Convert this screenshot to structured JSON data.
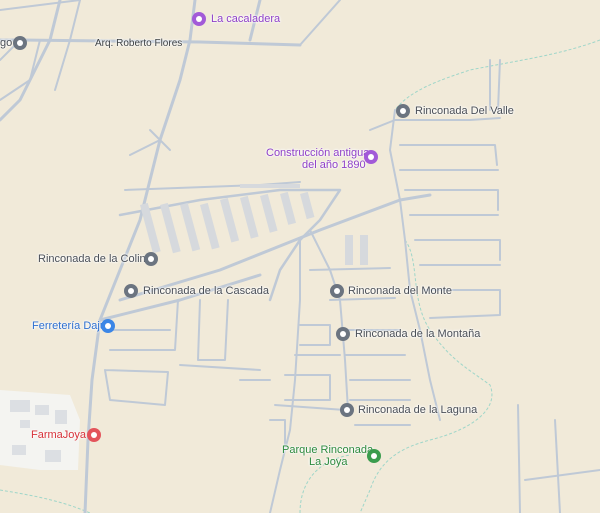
{
  "map": {
    "roads": [
      {
        "label": "Arq. Roberto Flores"
      }
    ],
    "places": [
      {
        "name": "La cacaladera",
        "category": "purple",
        "icon": "camera-icon"
      },
      {
        "name": "Rinconada Del Valle",
        "category": "grey",
        "icon": "pin-icon"
      },
      {
        "name": "Construcción antigua",
        "name_line2": "del año 1890",
        "category": "purple",
        "icon": "monument-icon"
      },
      {
        "name": "Rinconada de la Colina",
        "category": "grey",
        "icon": "pin-icon"
      },
      {
        "name": "Rinconada de la Cascada",
        "category": "grey",
        "icon": "pin-icon"
      },
      {
        "name": "Rinconada del Monte",
        "category": "grey",
        "icon": "pin-icon"
      },
      {
        "name": "Ferretería Dajui",
        "category": "blue",
        "icon": "shopping-bag-icon"
      },
      {
        "name": "Rinconada de la Montaña",
        "category": "grey",
        "icon": "pin-icon"
      },
      {
        "name": "Rinconada de la Laguna",
        "category": "grey",
        "icon": "pin-icon"
      },
      {
        "name": "FarmaJoya",
        "category": "red",
        "icon": "pharmacy-icon"
      },
      {
        "name": "Parque Rinconada",
        "name_line2": "La Joya",
        "category": "green",
        "icon": "tree-icon"
      },
      {
        "name": "go",
        "category": "grey",
        "icon": "pin-icon"
      }
    ],
    "colors": {
      "land": "#f1ead9",
      "road": "#bfc9d6",
      "road_outline": "#a9b6c6",
      "building": "#d6d9dd",
      "park_boundary": "#9fd6c9"
    }
  }
}
